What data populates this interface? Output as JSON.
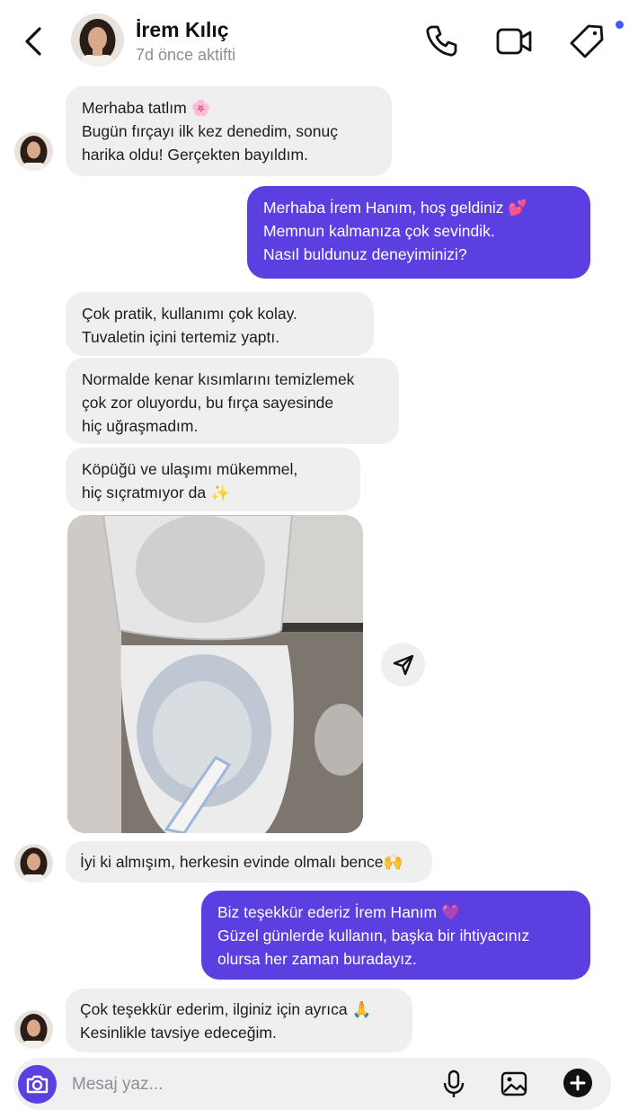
{
  "contact": {
    "name": "İrem Kılıç",
    "status": "7d önce aktifti"
  },
  "colors": {
    "outgoing_bubble": "#5b3fe0",
    "incoming_bubble": "#efefef",
    "accent_dot": "#3d5afe"
  },
  "header_icons": [
    "back-arrow-icon",
    "phone-icon",
    "video-camera-icon",
    "tag-icon"
  ],
  "messages": [
    {
      "dir": "in",
      "lines": [
        "Merhaba tatlım 🌸",
        "Bugün fırçayı ilk kez denedim, sonuç",
        "harika oldu! Gerçekten bayıldım."
      ]
    },
    {
      "dir": "out",
      "lines": [
        "Merhaba İrem Hanım, hoş geldiniz 💕",
        "Memnun kalmanıza çok sevindik.",
        "Nasıl buldunuz deneyiminizi?"
      ]
    },
    {
      "dir": "in",
      "lines": [
        "Çok pratik, kullanımı çok kolay.",
        "Tuvaletin içini tertemiz yaptı."
      ]
    },
    {
      "dir": "in",
      "lines": [
        "Normalde kenar kısımlarını temizlemek",
        "çok zor oluyordu, bu fırça sayesinde",
        "hiç uğraşmadım."
      ]
    },
    {
      "dir": "in",
      "lines": [
        "Köpüğü ve ulaşımı mükemmel,",
        "hiç sıçratmıyor da ✨"
      ]
    },
    {
      "dir": "in",
      "lines": [
        "İyi ki almışım, herkesin evinde olmalı bence🙌"
      ]
    },
    {
      "dir": "out",
      "lines": [
        "Biz teşekkür ederiz İrem Hanım 💜",
        "Güzel günlerde kullanın, başka bir ihtiyacınız",
        "olursa her zaman buradayız."
      ]
    },
    {
      "dir": "in",
      "lines": [
        "Çok teşekkür ederim, ilginiz için ayrıca 🙏",
        "Kesinlikle tavsiye edeceğim."
      ]
    }
  ],
  "composer": {
    "placeholder": "Mesaj yaz...",
    "icons": [
      "camera-icon",
      "microphone-icon",
      "gallery-icon",
      "plus-icon"
    ]
  }
}
